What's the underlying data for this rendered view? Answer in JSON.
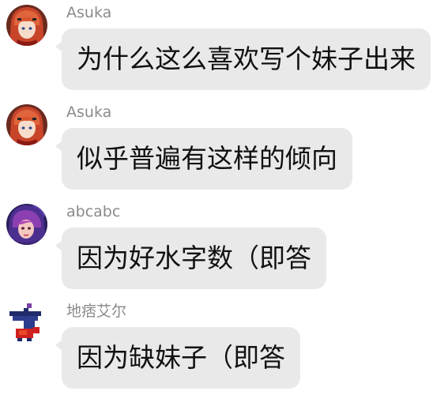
{
  "messages": [
    {
      "sender": "Asuka",
      "avatar_icon": "red-haired-anime-girl-avatar",
      "text": "为什么这么喜欢写个妹子出来"
    },
    {
      "sender": "Asuka",
      "avatar_icon": "red-haired-anime-girl-avatar",
      "text": "似乎普遍有这样的倾向"
    },
    {
      "sender": "abcabc",
      "avatar_icon": "purple-haired-anime-character-avatar",
      "text": "因为好水字数（即答"
    },
    {
      "sender": "地痞艾尔",
      "avatar_icon": "pixel-sprite-avatar",
      "text": "因为缺妹子（即答"
    }
  ],
  "colors": {
    "bubble_bg": "#e9e9e9",
    "sender_text": "#8a8a8a",
    "message_text": "#111111"
  }
}
